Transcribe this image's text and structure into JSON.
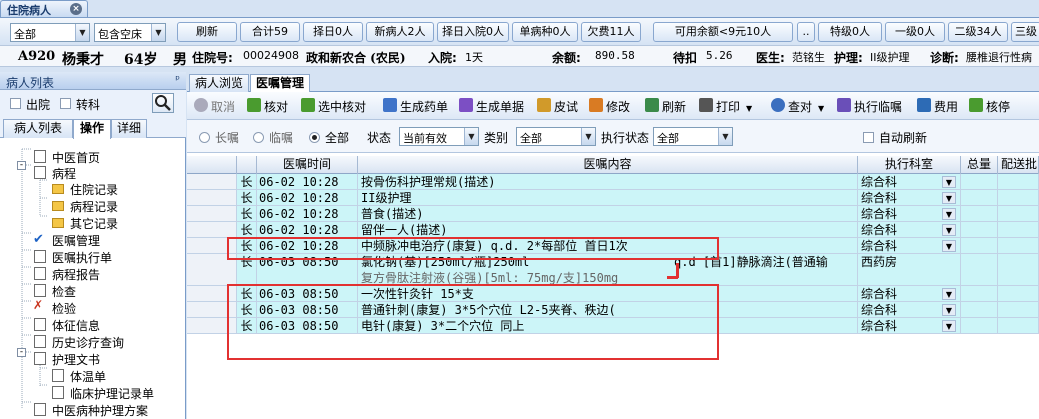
{
  "window": {
    "tab_title": "住院病人",
    "close": "×"
  },
  "toolbar1": {
    "combo_scope": "全部",
    "combo_bed": "包含空床",
    "buttons": [
      "刷新",
      "合计59",
      "择日0人",
      "新病人2人",
      "择日入院0人",
      "单病种0人",
      "欠费11人",
      "可用余额<9元10人",
      "特级0人",
      "一级0人",
      "二级34人",
      "三级"
    ],
    "dots": ".."
  },
  "patient": {
    "bed": "A920",
    "name": "杨秉才",
    "age": "64岁",
    "sex": "男",
    "admit_no_label": "住院号:",
    "admit_no": "00024908",
    "insurance": "政和新农合 (农民)",
    "in_label": "入院:",
    "in_days": "1天",
    "balance_label": "余额:",
    "balance": "890.58",
    "pending_label": "待扣",
    "pending": "5.26",
    "doctor_label": "医生:",
    "doctor": "范铭生",
    "nurse_label": "护理:",
    "nurse": "II级护理",
    "diag_label": "诊断:",
    "diag": "腰椎退行性病"
  },
  "left": {
    "title": "病人列表",
    "pin": "ᵖ",
    "opt_discharged": "出院",
    "opt_transfer": "转科",
    "tabs": [
      "病人列表",
      "操作",
      "详细"
    ],
    "tree": [
      "中医首页",
      "病程",
      "住院记录",
      "病程记录",
      "其它记录",
      "医嘱管理",
      "医嘱执行单",
      "病程报告",
      "检查",
      "检验",
      "体征信息",
      "历史诊疗查询",
      "护理文书",
      "体温单",
      "临床护理记录单",
      "中医病种护理方案"
    ]
  },
  "right": {
    "tabs": [
      "病人浏览",
      "医嘱管理"
    ],
    "toolbar": [
      "取消",
      "核对",
      "选中核对",
      "生成药单",
      "生成单据",
      "皮试",
      "修改",
      "刷新",
      "打印",
      "查对",
      "执行临嘱",
      "费用",
      "核停"
    ],
    "filter": {
      "long": "长嘱",
      "temp": "临嘱",
      "all": "全部",
      "status_label": "状态",
      "status_value": "当前有效",
      "category_label": "类别",
      "category_value": "全部",
      "exec_label": "执行状态",
      "exec_value": "全部",
      "auto_refresh": "自动刷新"
    },
    "columns": [
      "医嘱时间",
      "医嘱内容",
      "执行科室",
      "总量",
      "配送批"
    ],
    "rows": [
      {
        "type": "长",
        "time": "06-02 10:28",
        "content": "按骨伤科护理常规(描述)",
        "dept": "综合科"
      },
      {
        "type": "长",
        "time": "06-02 10:28",
        "content": "II级护理",
        "dept": "综合科"
      },
      {
        "type": "长",
        "time": "06-02 10:28",
        "content": "普食(描述)",
        "dept": "综合科"
      },
      {
        "type": "长",
        "time": "06-02 10:28",
        "content": "留伴一人(描述)",
        "dept": "综合科"
      },
      {
        "type": "长",
        "time": "06-02 10:28",
        "content": "中频脉冲电治疗(康复) q.d. 2*每部位 首日1次",
        "dept": "综合科"
      },
      {
        "type": "长",
        "time": "06-03 08:50",
        "content": "氯化钠(基)[250ml/瓶]250ml",
        "extra": "q.d  [首1]静脉滴注(普通输",
        "content2": "复方骨肽注射液(谷强)[5ml: 75mg/支]150mg",
        "dept": "西药房"
      },
      {
        "type": "长",
        "time": "06-03 08:50",
        "content": "一次性针灸针  15*支",
        "dept": "综合科"
      },
      {
        "type": "长",
        "time": "06-03 08:50",
        "content": "普通针刺(康复)  3*5个穴位 L2-5夹脊、秩边(",
        "dept": "综合科"
      },
      {
        "type": "长",
        "time": "06-03 08:50",
        "content": "电针(康复)  3*二个穴位 同上",
        "dept": "综合科"
      }
    ]
  }
}
